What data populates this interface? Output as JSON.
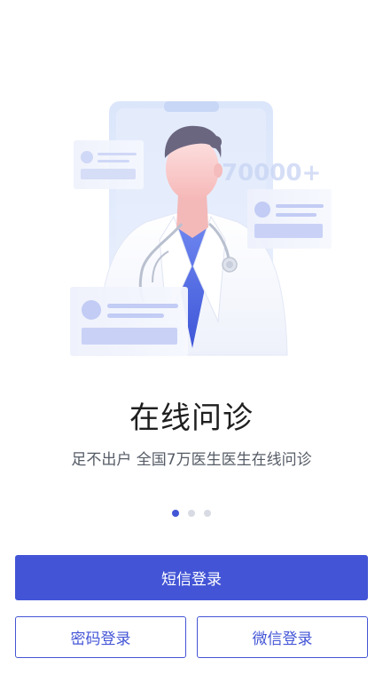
{
  "onboarding": {
    "badge_text": "70000+",
    "title": "在线问诊",
    "subtitle": "足不出户 全国7万医生医生在线问诊",
    "pages_total": 3,
    "active_page": 1
  },
  "actions": {
    "sms_login_label": "短信登录",
    "password_login_label": "密码登录",
    "wechat_login_label": "微信登录"
  },
  "colors": {
    "primary": "#4355d6",
    "background": "#ffffff",
    "title_text": "#1f1f1f",
    "subtitle_text": "#555b66",
    "dot_inactive": "#d8dbe3"
  },
  "icons": {
    "illustration": "doctor-illustration-icon"
  }
}
